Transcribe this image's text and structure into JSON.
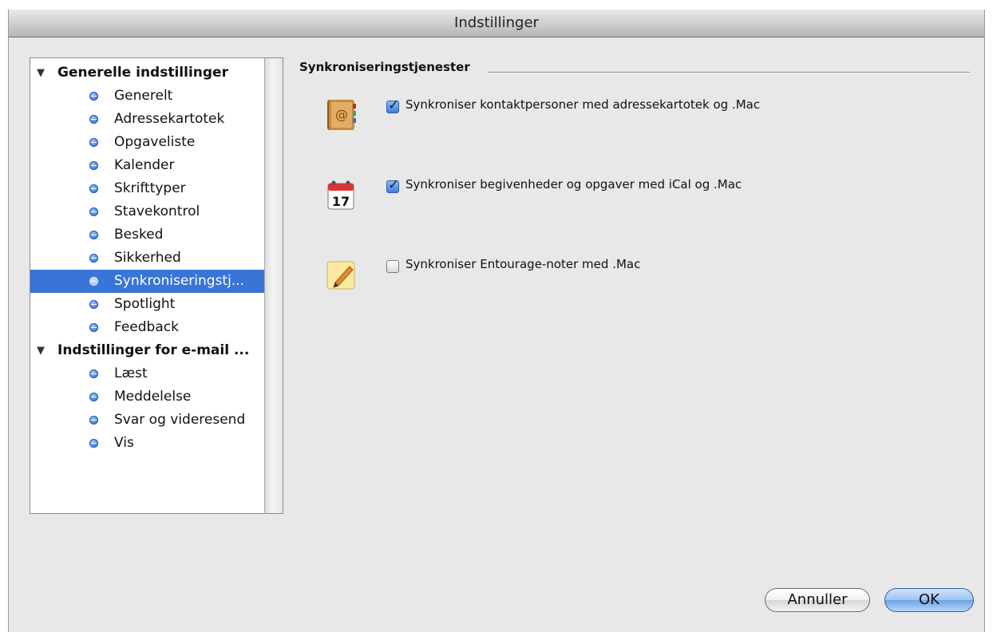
{
  "window": {
    "title": "Indstillinger"
  },
  "sidebar": {
    "groups": [
      {
        "label": "Generelle indstillinger",
        "items": [
          "Generelt",
          "Adressekartotek",
          "Opgaveliste",
          "Kalender",
          "Skrifttyper",
          "Stavekontrol",
          "Besked",
          "Sikkerhed",
          "Synkroniseringstj...",
          "Spotlight",
          "Feedback"
        ]
      },
      {
        "label": "Indstillinger for e-mail ...",
        "items": [
          "Læst",
          "Meddelelse",
          "Svar og videresend",
          "Vis"
        ]
      }
    ],
    "selected": "Synkroniseringstj..."
  },
  "main": {
    "section_title": "Synkroniseringstjenester",
    "options": [
      {
        "icon": "address-book-icon",
        "checked": true,
        "label": "Synkroniser kontaktpersoner med adressekartotek og .Mac"
      },
      {
        "icon": "calendar-icon",
        "checked": true,
        "label": "Synkroniser begivenheder og opgaver med iCal og .Mac",
        "calendar_day": "17"
      },
      {
        "icon": "notes-icon",
        "checked": false,
        "label": "Synkroniser Entourage-noter med .Mac"
      }
    ]
  },
  "buttons": {
    "cancel": "Annuller",
    "ok": "OK"
  },
  "colors": {
    "selection": "#3875d7",
    "window_bg": "#e8e8e8"
  }
}
